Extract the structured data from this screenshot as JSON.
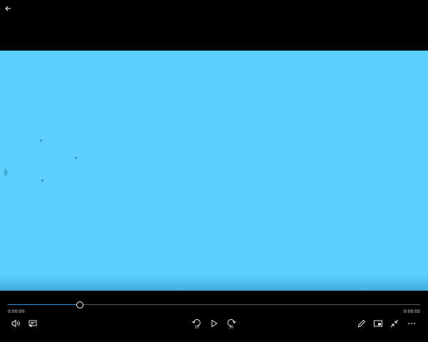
{
  "window": {
    "back_icon": "back-arrow-icon"
  },
  "video": {
    "background": "#5cd1fd"
  },
  "player": {
    "current_time": "0:00:00",
    "duration": "0:00:05",
    "progress": 0.175,
    "accent": "#3b8fd6"
  },
  "controls": {
    "left": [
      "volume-icon",
      "subtitles-icon"
    ],
    "center": [
      "skip-back-10-icon",
      "play-icon",
      "skip-forward-30-icon"
    ],
    "right": [
      "edit-pencil-icon",
      "mini-view-icon",
      "exit-fullscreen-icon",
      "more-icon"
    ],
    "skip_back_label": "10",
    "skip_forward_label": "30"
  }
}
